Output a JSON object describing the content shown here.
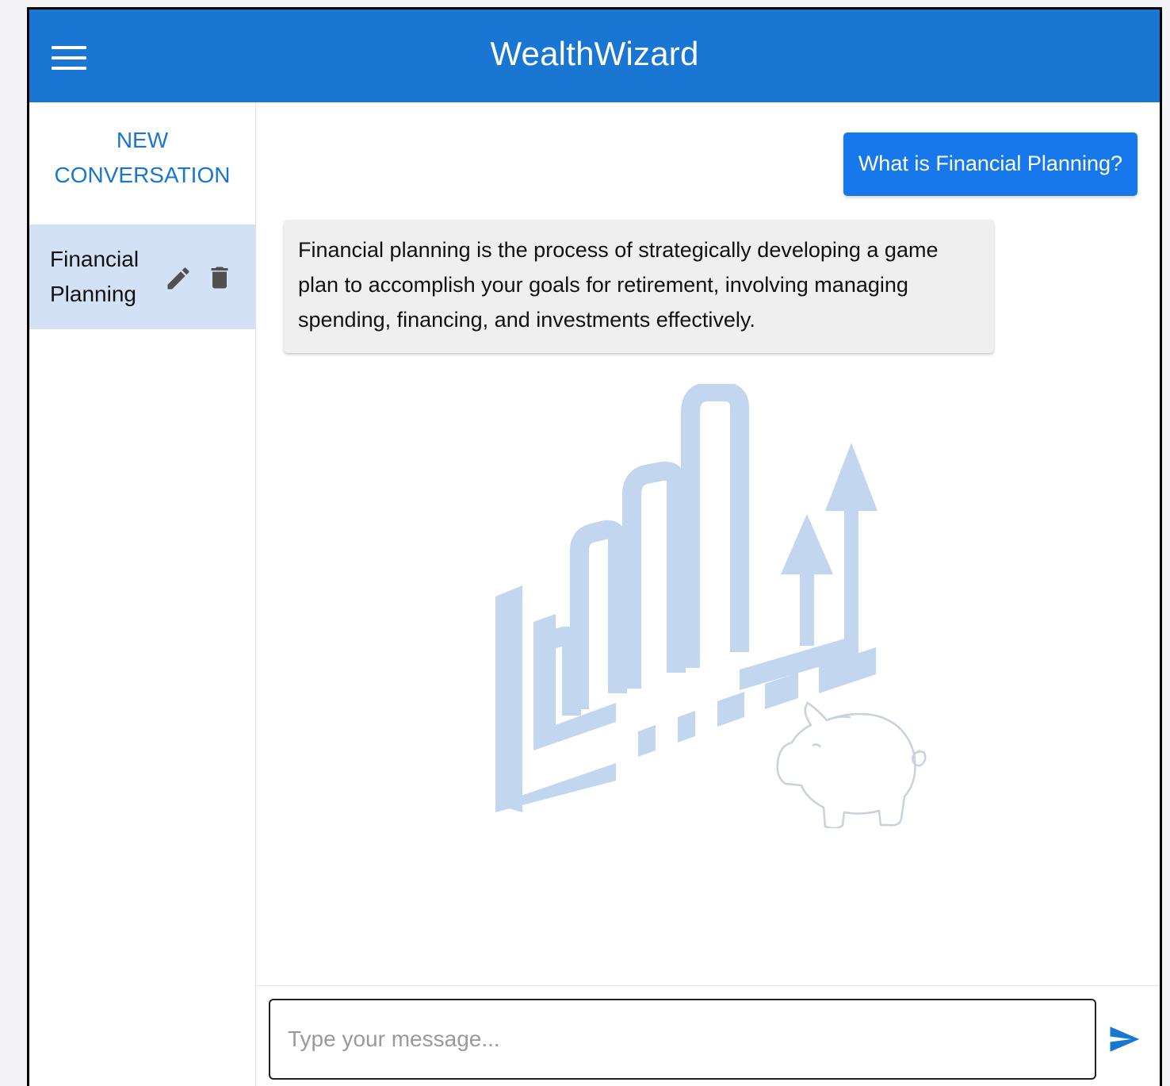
{
  "app": {
    "title": "WealthWizard",
    "accent_color": "#1976d2"
  },
  "header": {
    "menu_icon": "hamburger-menu-icon"
  },
  "sidebar": {
    "new_conversation_label": "NEW CONVERSATION",
    "conversations": [
      {
        "title": "Financial Planning",
        "selected": true,
        "edit_icon": "pencil-icon",
        "delete_icon": "trash-icon"
      }
    ]
  },
  "chat": {
    "messages": [
      {
        "role": "user",
        "text": "What is Financial Planning?"
      },
      {
        "role": "assistant",
        "text": "Financial planning is the process of strategically developing a game plan to accomplish your goals for retirement, involving managing spending, financing, and investments effectively."
      }
    ],
    "illustration_icon": "growth-chart-piggy-bank-illustration"
  },
  "composer": {
    "placeholder": "Type your message...",
    "value": "",
    "send_icon": "send-icon"
  }
}
